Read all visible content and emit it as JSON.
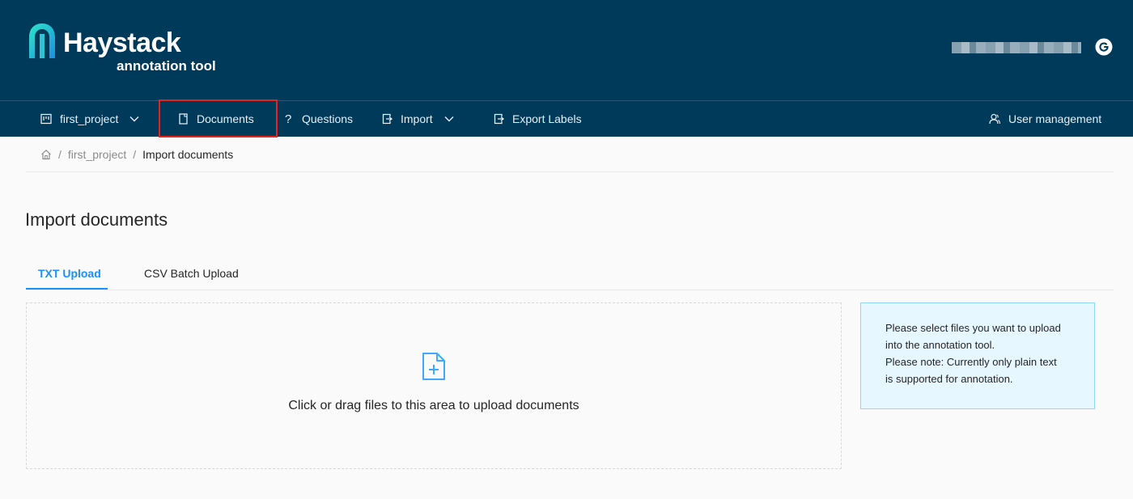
{
  "app": {
    "logo_name": "Haystack",
    "logo_subtitle": "annotation tool",
    "user_icon": "user-circle-icon"
  },
  "nav": {
    "project": {
      "label": "first_project",
      "icon": "project-icon"
    },
    "documents": {
      "label": "Documents",
      "icon": "document-icon"
    },
    "questions": {
      "label": "Questions",
      "icon": "question-icon"
    },
    "import": {
      "label": "Import",
      "icon": "import-icon"
    },
    "export": {
      "label": "Export Labels",
      "icon": "export-icon"
    },
    "user_management": {
      "label": "User management",
      "icon": "users-icon"
    }
  },
  "breadcrumb": {
    "items": [
      "first_project",
      "Import documents"
    ],
    "separator": "/"
  },
  "page": {
    "title": "Import documents"
  },
  "tabs": [
    {
      "label": "TXT Upload",
      "active": true
    },
    {
      "label": "CSV Batch Upload",
      "active": false
    }
  ],
  "upload": {
    "text": "Click or drag files to this area to upload documents",
    "icon": "file-add-icon"
  },
  "info": {
    "line1": "Please select files you want to upload",
    "line2": "into the annotation tool.",
    "line3": "Please note: Currently only plain text",
    "line4": "is supported for annotation."
  },
  "colors": {
    "header_bg": "#003a5b",
    "accent": "#1890ff",
    "highlight": "#e8231b",
    "info_bg": "#e6f7ff"
  }
}
